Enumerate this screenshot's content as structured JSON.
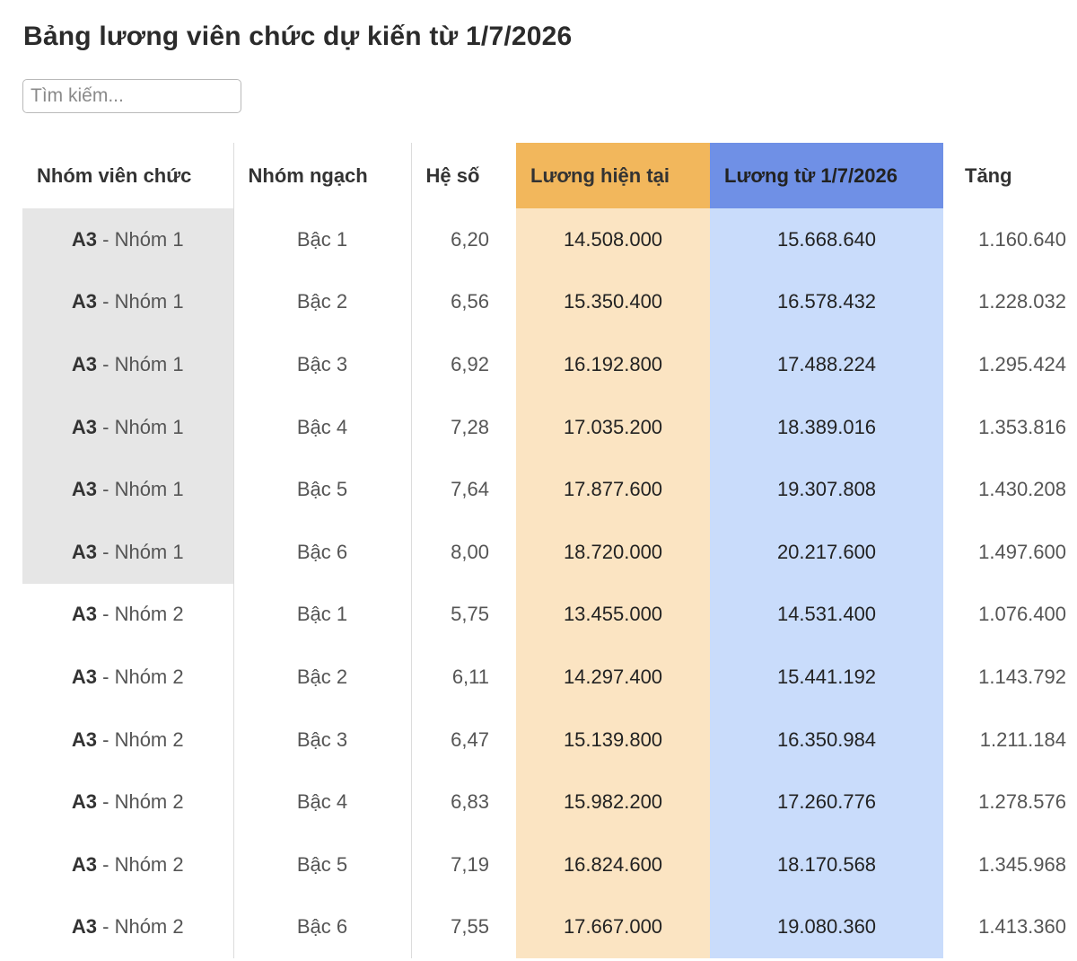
{
  "page": {
    "title": "Bảng lương viên chức dự kiến từ 1/7/2026",
    "search_placeholder": "Tìm kiếm..."
  },
  "table": {
    "headers": [
      "Nhóm viên chức",
      "Nhóm ngạch",
      "Hệ số",
      "Lương hiện tại",
      "Lương từ 1/7/2026",
      "Tăng"
    ],
    "rows": [
      {
        "code": "A3",
        "group": " - Nhóm 1",
        "grade": "Bậc 1",
        "coef": "6,20",
        "current": "14.508.000",
        "new": "15.668.640",
        "increase": "1.160.640"
      },
      {
        "code": "A3",
        "group": " - Nhóm 1",
        "grade": "Bậc 2",
        "coef": "6,56",
        "current": "15.350.400",
        "new": "16.578.432",
        "increase": "1.228.032"
      },
      {
        "code": "A3",
        "group": " - Nhóm 1",
        "grade": "Bậc 3",
        "coef": "6,92",
        "current": "16.192.800",
        "new": "17.488.224",
        "increase": "1.295.424"
      },
      {
        "code": "A3",
        "group": " - Nhóm 1",
        "grade": "Bậc 4",
        "coef": "7,28",
        "current": "17.035.200",
        "new": "18.389.016",
        "increase": "1.353.816"
      },
      {
        "code": "A3",
        "group": " - Nhóm 1",
        "grade": "Bậc 5",
        "coef": "7,64",
        "current": "17.877.600",
        "new": "19.307.808",
        "increase": "1.430.208"
      },
      {
        "code": "A3",
        "group": " - Nhóm 1",
        "grade": "Bậc 6",
        "coef": "8,00",
        "current": "18.720.000",
        "new": "20.217.600",
        "increase": "1.497.600"
      },
      {
        "code": "A3",
        "group": " - Nhóm 2",
        "grade": "Bậc 1",
        "coef": "5,75",
        "current": "13.455.000",
        "new": "14.531.400",
        "increase": "1.076.400"
      },
      {
        "code": "A3",
        "group": " - Nhóm 2",
        "grade": "Bậc 2",
        "coef": "6,11",
        "current": "14.297.400",
        "new": "15.441.192",
        "increase": "1.143.792"
      },
      {
        "code": "A3",
        "group": " - Nhóm 2",
        "grade": "Bậc 3",
        "coef": "6,47",
        "current": "15.139.800",
        "new": "16.350.984",
        "increase": "1.211.184"
      },
      {
        "code": "A3",
        "group": " - Nhóm 2",
        "grade": "Bậc 4",
        "coef": "6,83",
        "current": "15.982.200",
        "new": "17.260.776",
        "increase": "1.278.576"
      },
      {
        "code": "A3",
        "group": " - Nhóm 2",
        "grade": "Bậc 5",
        "coef": "7,19",
        "current": "16.824.600",
        "new": "18.170.568",
        "increase": "1.345.968"
      },
      {
        "code": "A3",
        "group": " - Nhóm 2",
        "grade": "Bậc 6",
        "coef": "7,55",
        "current": "17.667.000",
        "new": "19.080.360",
        "increase": "1.413.360"
      }
    ]
  },
  "colors": {
    "current_header": "#f2b75c",
    "current_cell": "#fbe4c2",
    "new_header": "#6f90e6",
    "new_cell": "#c9dcfb",
    "group1_cell": "#e6e6e6"
  }
}
